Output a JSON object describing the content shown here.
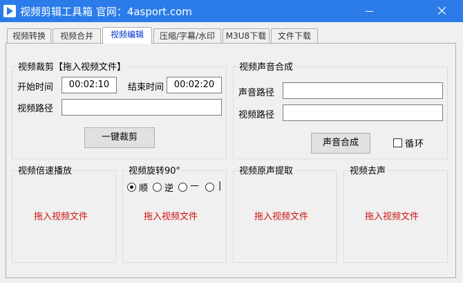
{
  "window": {
    "title": "视频剪辑工具箱 官网：4asport.com"
  },
  "tabs": [
    {
      "label": "视频转换"
    },
    {
      "label": "视频合并"
    },
    {
      "label": "视频编辑",
      "active": true
    },
    {
      "label": "压缩/字幕/水印"
    },
    {
      "label": "M3U8下载"
    },
    {
      "label": "文件下载"
    }
  ],
  "trim": {
    "title": "视频裁剪【拖入视频文件】",
    "start_label": "开始时间",
    "start_value": "00:02:10",
    "end_label": "结束时间",
    "end_value": "00:02:20",
    "path_label": "视频路径",
    "path_value": "",
    "button": "一键裁剪"
  },
  "audio_merge": {
    "title": "视频声音合成",
    "audio_path_label": "声音路径",
    "audio_path_value": "",
    "video_path_label": "视频路径",
    "video_path_value": "",
    "button": "声音合成",
    "loop_label": "循环",
    "loop_checked": false
  },
  "speed": {
    "title": "视频倍速播放",
    "drop_hint": "拖入视频文件"
  },
  "rotate": {
    "title": "视频旋转90°",
    "options": [
      {
        "label": "顺",
        "checked": true
      },
      {
        "label": "逆",
        "checked": false
      },
      {
        "label": "—",
        "checked": false
      },
      {
        "label": "|",
        "checked": false
      }
    ],
    "drop_hint": "拖入视频文件"
  },
  "extract_audio": {
    "title": "视频原声提取",
    "drop_hint": "拖入视频文件"
  },
  "mute": {
    "title": "视频去声",
    "drop_hint": "拖入视频文件"
  }
}
